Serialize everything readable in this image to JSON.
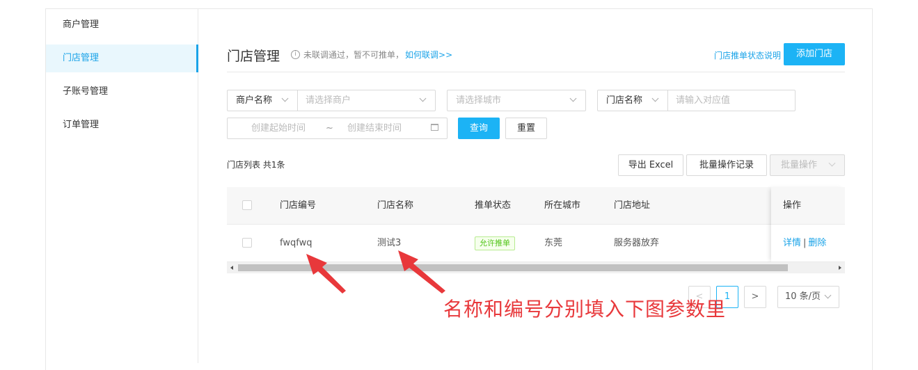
{
  "sidebar": {
    "items": [
      {
        "label": "商户管理",
        "active": false
      },
      {
        "label": "门店管理",
        "active": true
      },
      {
        "label": "子账号管理",
        "active": false
      },
      {
        "label": "订单管理",
        "active": false
      }
    ]
  },
  "header": {
    "title": "门店管理",
    "tip_text": "未联调通过，暂不可推单，",
    "tip_link": "如何联调>>",
    "status_help": "门店推单状态说明",
    "add_button": "添加门店"
  },
  "filters": {
    "merchant_prefix": "商户名称",
    "merchant_placeholder": "请选择商户",
    "city_placeholder": "请选择城市",
    "store_prefix": "门店名称",
    "store_placeholder": "请输入对应值",
    "start_placeholder": "创建起始时间",
    "range_sep": "~",
    "end_placeholder": "创建结束时间",
    "query_button": "查询",
    "reset_button": "重置"
  },
  "list": {
    "title": "门店列表 共1条",
    "export_button": "导出 Excel",
    "batch_log_button": "批量操作记录",
    "batch_button": "批量操作"
  },
  "table": {
    "columns": [
      "门店编号",
      "门店名称",
      "推单状态",
      "所在城市",
      "门店地址",
      "操作"
    ],
    "rows": [
      {
        "code": "fwqfwq",
        "name": "测试3",
        "status": "允许推单",
        "city": "东莞",
        "address": "服务器放弃",
        "actions": {
          "detail": "详情",
          "sep": "|",
          "delete": "删除"
        }
      }
    ]
  },
  "pagination": {
    "prev": "<",
    "current_page": "1",
    "next": ">",
    "page_size": "10 条/页"
  },
  "annotation": {
    "text": "名称和编号分别填入下图参数里",
    "color": "#e8383b"
  },
  "colors": {
    "accent": "#1cb3f5",
    "link": "#1aa3e8",
    "success": "#52c41a"
  }
}
